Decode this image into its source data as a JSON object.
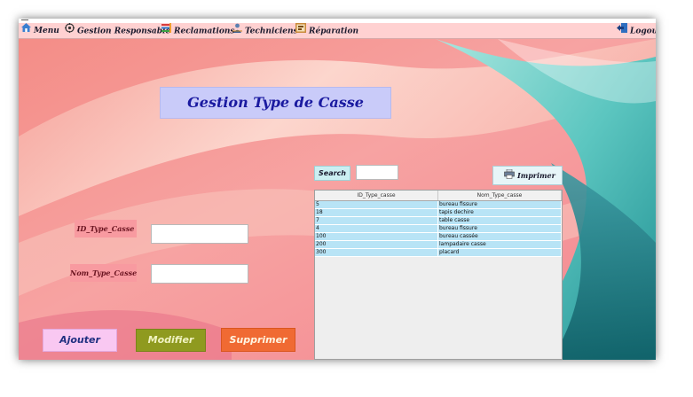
{
  "menubar": {
    "items": [
      {
        "label": "Menu",
        "icon": "home-icon"
      },
      {
        "label": "Gestion Responsable",
        "icon": "settings-icon"
      },
      {
        "label": "Reclamations",
        "icon": "list-icon"
      },
      {
        "label": "Techniciens",
        "icon": "technician-icon"
      },
      {
        "label": "Réparation",
        "icon": "repair-icon"
      }
    ],
    "logout_label": "Logout"
  },
  "page": {
    "title": "Gestion Type de Casse"
  },
  "form": {
    "id_label": "ID_Type_Casse",
    "id_value": "",
    "nom_label": "Nom_Type_Casse",
    "nom_value": ""
  },
  "buttons": {
    "add": "Ajouter",
    "edit": "Modifier",
    "delete": "Supprimer"
  },
  "search": {
    "label": "Search",
    "value": ""
  },
  "print": {
    "label": "Imprimer"
  },
  "table": {
    "columns": [
      "ID_Type_casse",
      "Nom_Type_casse"
    ],
    "rows": [
      [
        "5",
        "bureau fissure"
      ],
      [
        "18",
        "tapis dechire"
      ],
      [
        "7",
        "table casse"
      ],
      [
        "4",
        "bureau fissure"
      ],
      [
        "100",
        "bureau cassée"
      ],
      [
        "200",
        "lampadaire casse"
      ],
      [
        "300",
        "placard"
      ]
    ]
  },
  "colors": {
    "menubar_bg": "#ffd1d1",
    "title_bg": "#c9cbf9",
    "title_text": "#1a1aa0",
    "label_bg": "#f89aa0",
    "add_bg": "#f9c8f2",
    "edit_bg": "#8f9a1f",
    "delete_bg": "#f06a33",
    "row_bg": "#b8e4f6"
  }
}
